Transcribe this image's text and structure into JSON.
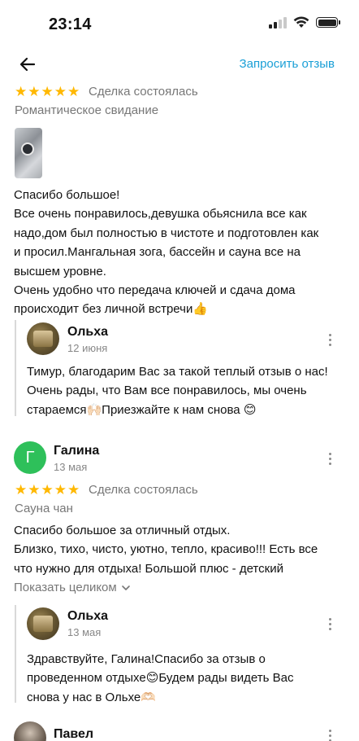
{
  "status_bar": {
    "time": "23:14"
  },
  "header": {
    "request_review_label": "Запросить отзыв"
  },
  "icons": {
    "back": "arrow-left-icon",
    "more": "kebab-menu-icon",
    "chevron": "chevron-down-icon"
  },
  "colors": {
    "accent": "#1a9fd6",
    "star": "#ffb800",
    "avatar_green": "#2ec05a"
  },
  "reviews": [
    {
      "rating": 5,
      "status": "Сделка состоялась",
      "listing": "Романтическое свидание",
      "lines": [
        "Спасибо большое!",
        "Все очень понравилось,девушка обьяснила все как",
        "надо,дом был полностью в чистоте и подготовлен как",
        "и просил.Мангальная зога, бассейн и сауна все на",
        "высшем уровне.",
        "Очень удобно что передача ключей и сдача дома",
        "происходит без личной встречи👍"
      ],
      "reply": {
        "author": "Ольха",
        "date": "12 июня",
        "lines": [
          "Тимур, благодарим Вас за такой теплый отзыв о нас!",
          "Очень рады, что Вам все понравилось, мы очень",
          "стараемся🙌🏻Приезжайте к нам снова 😊"
        ]
      }
    },
    {
      "author": "Галина",
      "avatar_letter": "Г",
      "date": "13 мая",
      "rating": 5,
      "status": "Сделка состоялась",
      "listing": "Сауна чан",
      "lines": [
        "Спасибо большое за отличный отдых.",
        "Близко, тихо, чисто, уютно, тепло, красиво!!! Есть все",
        "что нужно для отдыха! Большой плюс - детский"
      ],
      "show_more": "Показать целиком",
      "reply": {
        "author": "Ольха",
        "date": "13 мая",
        "lines": [
          "Здравствуйте, Галина!Спасибо за отзыв о",
          "проведенном отдыхе😊Будем рады видеть Вас",
          "снова у нас в Ольхе🫶🏻"
        ]
      }
    },
    {
      "author": "Павел"
    }
  ]
}
